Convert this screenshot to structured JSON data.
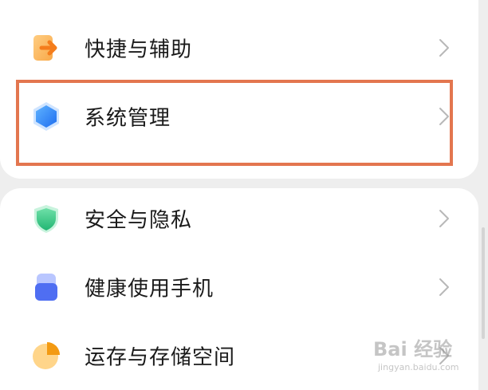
{
  "settings": {
    "items": [
      {
        "label": "快捷与辅助",
        "icon": "shortcut-arrow-icon"
      },
      {
        "label": "系统管理",
        "icon": "hexagon-system-icon",
        "highlighted": true
      },
      {
        "label": "安全与隐私",
        "icon": "shield-icon"
      },
      {
        "label": "健康使用手机",
        "icon": "health-usage-icon"
      },
      {
        "label": "运存与存储空间",
        "icon": "storage-pie-icon"
      }
    ]
  },
  "colors": {
    "highlight_border": "#e3764f",
    "shortcut_icon": "#f7a23b",
    "system_icon": "#2f86f5",
    "shield_icon": "#34c58a",
    "health_icon": "#4f6ef2",
    "storage_icon": "#f6a623"
  },
  "watermark": {
    "main": "Bai 经验",
    "sub": "jingyan.baidu.com"
  }
}
